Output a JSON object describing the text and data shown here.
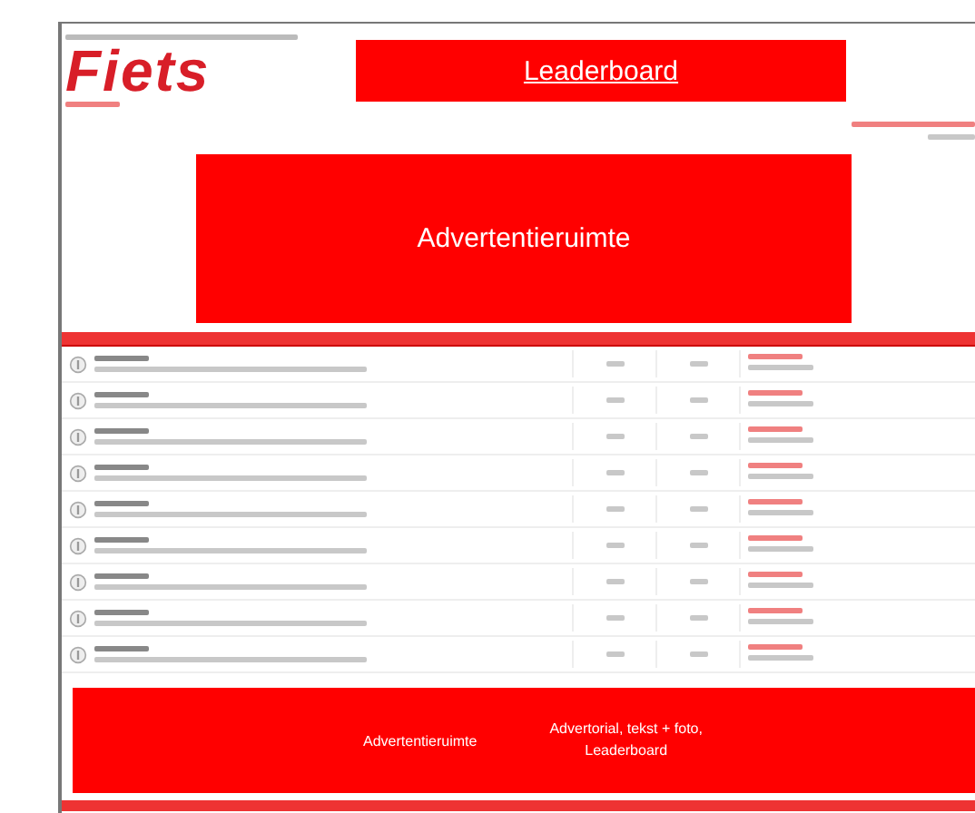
{
  "logo": {
    "text": "Fiets"
  },
  "leaderboard": {
    "text": "Leaderboard"
  },
  "main_ad": {
    "text": "Advertentieruimte"
  },
  "forums": [
    {
      "kind": "forum"
    },
    {
      "kind": "forum"
    },
    {
      "kind": "forum"
    },
    {
      "kind": "forum"
    },
    {
      "kind": "forum"
    },
    {
      "kind": "forum"
    },
    {
      "kind": "forum"
    },
    {
      "kind": "forum"
    },
    {
      "kind": "forum"
    }
  ],
  "bottom_ad": {
    "left": "Advertentieruimte",
    "right_lines": [
      "Advertorial, tekst + foto,",
      "Leaderboard"
    ]
  }
}
